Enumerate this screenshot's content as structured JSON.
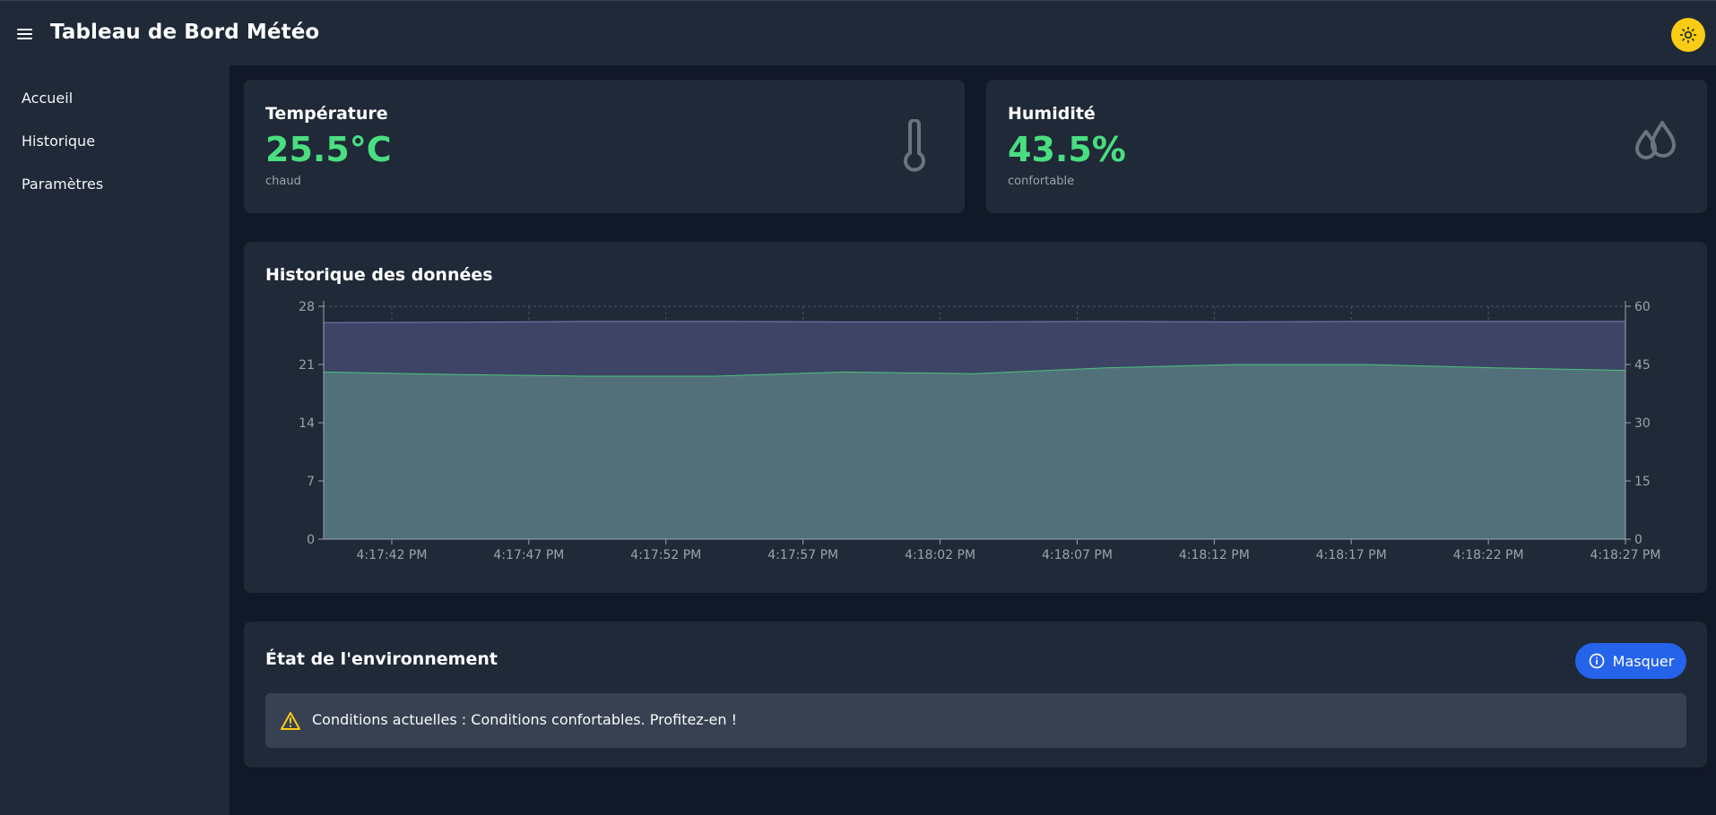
{
  "header": {
    "title": "Tableau de Bord Météo",
    "menu_icon": "hamburger-menu-icon",
    "theme_icon": "sun-icon"
  },
  "sidebar": {
    "items": [
      {
        "label": "Accueil"
      },
      {
        "label": "Historique"
      },
      {
        "label": "Paramètres"
      }
    ]
  },
  "temperature": {
    "title": "Température",
    "value": "25.5°C",
    "status": "chaud",
    "icon": "thermometer-icon"
  },
  "humidity": {
    "title": "Humidité",
    "value": "43.5%",
    "status": "confortable",
    "icon": "droplets-icon"
  },
  "history": {
    "title": "Historique des données"
  },
  "environment": {
    "title": "État de l'environnement",
    "button_label": "Masquer",
    "button_icon": "info-icon",
    "alert_text": "Conditions actuelles : Conditions confortables. Profitez-en !",
    "alert_icon": "warning-icon"
  },
  "colors": {
    "accent_green": "#4ade80",
    "primary_blue": "#2563eb",
    "theme_yellow": "#facc15",
    "temperature_area": "#52707a",
    "humidity_area": "#3e4466"
  },
  "chart_data": {
    "type": "area",
    "x": [
      "4:17:42 PM",
      "4:17:47 PM",
      "4:17:52 PM",
      "4:17:57 PM",
      "4:18:02 PM",
      "4:18:07 PM",
      "4:18:12 PM",
      "4:18:17 PM",
      "4:18:22 PM",
      "4:18:27 PM"
    ],
    "x_extent": [
      "",
      "4:18:27 PM"
    ],
    "series": [
      {
        "axis": "left",
        "color": "#52707a",
        "stroke": "#4ade80",
        "values": [
          20.1,
          19.8,
          19.6,
          19.6,
          20.1,
          19.9,
          20.6,
          21.0,
          21.0,
          20.6,
          20.3
        ]
      },
      {
        "axis": "right",
        "color": "#3e4466",
        "stroke": "#8b93d6",
        "values": [
          55.8,
          55.9,
          56.1,
          56.1,
          56.0,
          56.0,
          56.1,
          56.0,
          56.1,
          56.1,
          56.1
        ]
      }
    ],
    "y_left": {
      "ticks": [
        0,
        7,
        14,
        21,
        28
      ],
      "range": [
        0,
        28
      ]
    },
    "y_right": {
      "ticks": [
        0,
        15,
        30,
        45,
        60
      ],
      "range": [
        0,
        60
      ]
    },
    "grid": true
  }
}
